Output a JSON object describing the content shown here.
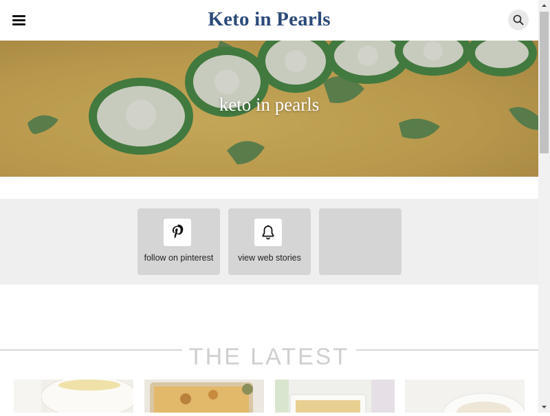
{
  "header": {
    "site_title": "Keto in Pearls",
    "menu_icon": "hamburger-menu-icon",
    "search_icon": "search-icon"
  },
  "hero": {
    "title": "keto in pearls"
  },
  "links": [
    {
      "label": "follow on pinterest",
      "icon": "pinterest-icon"
    },
    {
      "label": "view web stories",
      "icon": "bell-icon"
    },
    {
      "label": "",
      "icon": ""
    }
  ],
  "latest": {
    "heading": "THE LATEST"
  },
  "colors": {
    "brand": "#2b4a78",
    "strip_bg": "#efefef",
    "card_bg": "#d5d5d5"
  }
}
